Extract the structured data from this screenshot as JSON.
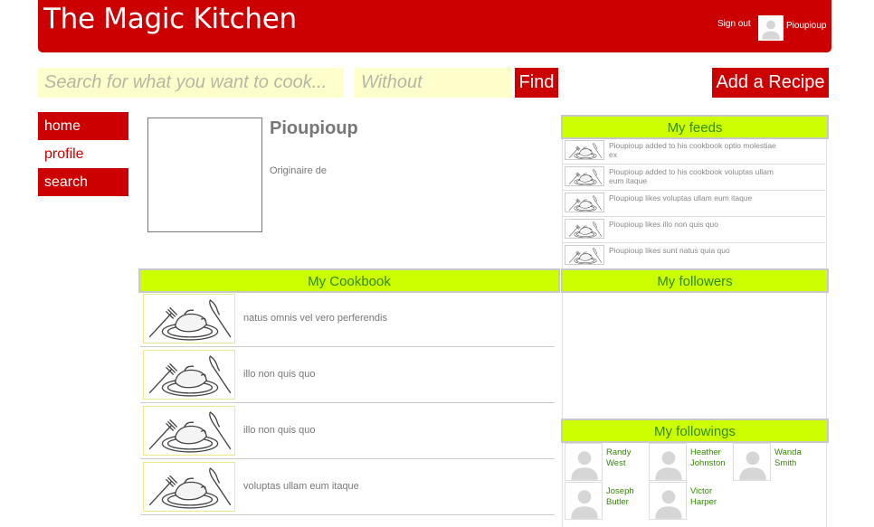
{
  "header": {
    "title": "The Magic Kitchen",
    "signout_label": "Sign out",
    "username": "Pioupioup"
  },
  "search": {
    "search_placeholder": "Search for what you want to cook...",
    "without_placeholder": "Without",
    "find_label": "Find",
    "add_recipe_label": "Add a Recipe"
  },
  "nav": {
    "items": [
      {
        "label": "home"
      },
      {
        "label": "profile"
      },
      {
        "label": "search"
      }
    ]
  },
  "profile": {
    "name": "Pioupioup",
    "origin_label": "Originaire de"
  },
  "feeds": {
    "title": "My feeds",
    "items": [
      {
        "text": "Pioupioup added to his cookbook optio molestiae ex"
      },
      {
        "text": "Pioupioup added to his cookbook voluptas ullam eum itaque"
      },
      {
        "text": "Pioupioup likes voluptas ullam eum itaque"
      },
      {
        "text": "Pioupioup likes illo non quis quo"
      },
      {
        "text": "Pioupioup likes sunt natus quia quo"
      }
    ]
  },
  "cookbook": {
    "title": "My Cookbook",
    "items": [
      {
        "title": "natus omnis vel vero perferendis"
      },
      {
        "title": "illo non quis quo"
      },
      {
        "title": "illo non quis quo"
      },
      {
        "title": "voluptas ullam eum itaque"
      }
    ]
  },
  "followers": {
    "title": "My followers"
  },
  "followings": {
    "title": "My followings",
    "items": [
      {
        "name": "Randy West"
      },
      {
        "name": "Heather Johnston"
      },
      {
        "name": "Wanda Smith"
      },
      {
        "name": "Joseph Butler"
      },
      {
        "name": "Victor Harper"
      }
    ]
  },
  "colors": {
    "brand_red": "#cc0000",
    "section_green": "#ccff00",
    "search_yellow": "#ffffcc",
    "link_green": "#338a00"
  }
}
